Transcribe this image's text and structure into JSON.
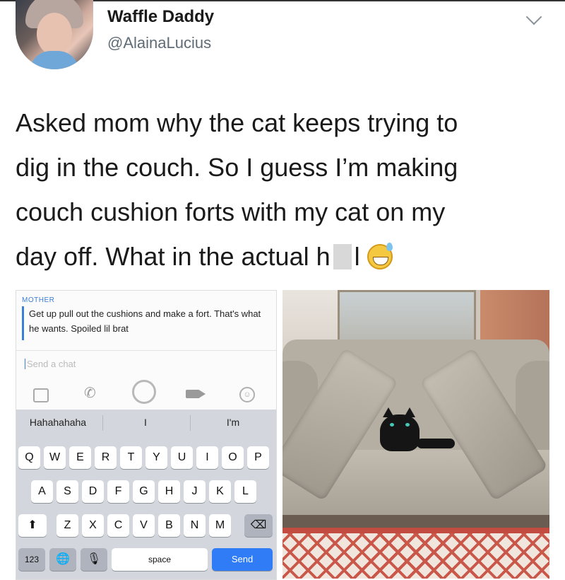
{
  "tweet": {
    "display_name": "Waffle Daddy",
    "handle": "@AlainaLucius",
    "text_lines": [
      "Asked mom why the cat keeps trying to",
      "dig in the couch. So I guess I’m making",
      "couch cushion forts with my cat on my",
      "day off. What in the actual h"
    ],
    "censored_end": "l",
    "emoji": "grinning-sweat-emoji"
  },
  "chat": {
    "sender": "MOTHER",
    "message": "Get up pull out the cushions and make a fort. That's what he wants.  Spoiled lil brat",
    "input_placeholder": "Send a chat"
  },
  "keyboard": {
    "suggestions": [
      "Hahahahaha",
      "I",
      "I'm"
    ],
    "row1": [
      "Q",
      "W",
      "E",
      "R",
      "T",
      "Y",
      "U",
      "I",
      "O",
      "P"
    ],
    "row2": [
      "A",
      "S",
      "D",
      "F",
      "G",
      "H",
      "J",
      "K",
      "L"
    ],
    "row3": [
      "Z",
      "X",
      "C",
      "V",
      "B",
      "N",
      "M"
    ],
    "numbers_label": "123",
    "space_label": "space",
    "send_label": "Send"
  },
  "photo": {
    "subject": "cat-in-cushion-fort"
  }
}
